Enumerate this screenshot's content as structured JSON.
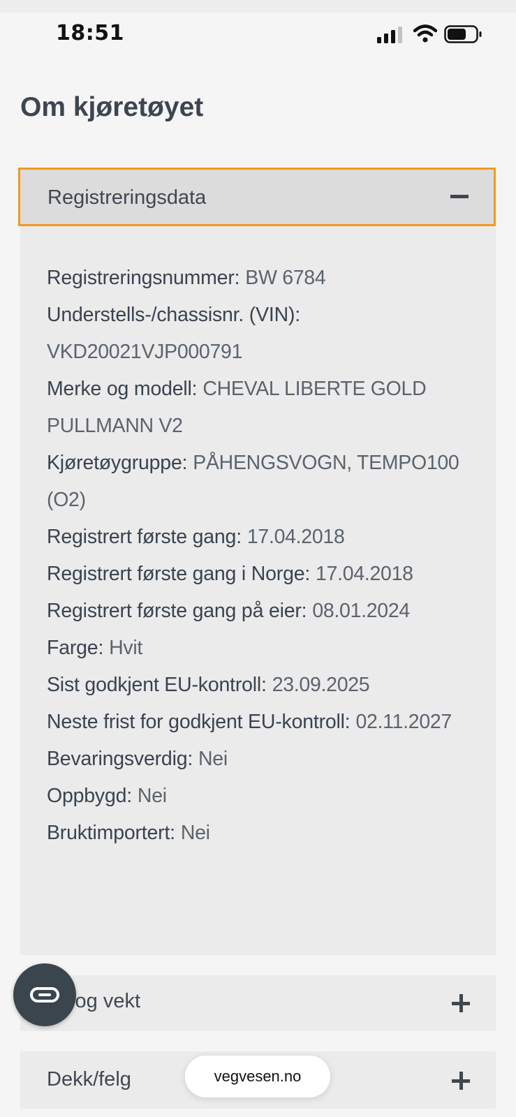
{
  "status_bar": {
    "time": "18:51"
  },
  "page": {
    "title": "Om kjøretøyet"
  },
  "sections": [
    {
      "label": "Registreringsdata",
      "expanded": true,
      "rows": [
        {
          "label": "Registreringsnummer:",
          "value": "BW 6784"
        },
        {
          "label": "Understells-/chassisnr. (VIN):",
          "value": "VKD20021VJP000791"
        },
        {
          "label": "Merke og modell:",
          "value": "CHEVAL LIBERTE GOLD PULLMANN V2"
        },
        {
          "label": "Kjøretøygruppe:",
          "value": "PÅHENGSVOGN, TEMPO100 (O2)"
        },
        {
          "label": "Registrert første gang:",
          "value": "17.04.2018"
        },
        {
          "label": "Registrert første gang i Norge:",
          "value": "17.04.2018"
        },
        {
          "label": "Registrert første gang på eier:",
          "value": "08.01.2024"
        },
        {
          "label": "Farge:",
          "value": "Hvit"
        },
        {
          "label": "Sist godkjent EU-kontroll:",
          "value": "23.09.2025"
        },
        {
          "label": "Neste frist for godkjent EU-kontroll:",
          "value": "02.11.2027"
        },
        {
          "label": "Bevaringsverdig:",
          "value": "Nei"
        },
        {
          "label": "Oppbygd:",
          "value": "Nei"
        },
        {
          "label": "Bruktimportert:",
          "value": "Nei"
        }
      ]
    },
    {
      "label": "Mål og vekt",
      "visible_label": "l og vekt",
      "expanded": false
    },
    {
      "label": "Dekk/felg",
      "expanded": false
    }
  ],
  "browser": {
    "url": "vegvesen.no"
  },
  "colors": {
    "focus_border": "#f29a1c",
    "header_bg": "#dcdcdc",
    "body_bg": "#ebebeb",
    "text": "#3f4750",
    "fab_bg": "#3b454e"
  },
  "icons": {
    "collapse": "minus-icon",
    "expand": "plus-icon",
    "fab": "chat-link-icon"
  }
}
